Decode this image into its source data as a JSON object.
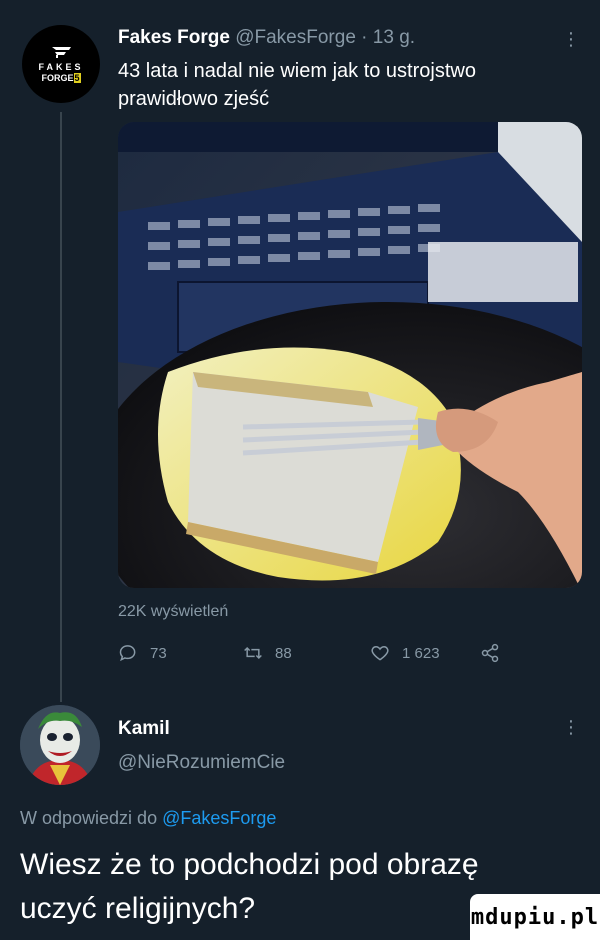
{
  "tweet": {
    "author_name": "Fakes Forge",
    "author_handle": "@FakesForge",
    "separator": "·",
    "time": "13 g.",
    "text": "43 lata i nadal nie wiem jak to ustrojstwo prawidłowo zjeść",
    "avatar": {
      "line1": "FAKES",
      "line2": "FORGE",
      "badge": "5"
    },
    "views": "22K wyświetleń",
    "stats": {
      "replies": "73",
      "retweets": "88",
      "likes": "1 623"
    },
    "icons": {
      "reply": "reply-icon",
      "retweet": "retweet-icon",
      "like": "heart-icon",
      "share": "share-icon",
      "more": "more-icon"
    }
  },
  "reply": {
    "author_name": "Kamil",
    "author_handle": "@NieRozumiemCie",
    "context_prefix": "W odpowiedzi do",
    "context_mention": "@FakesForge",
    "text": "Wiesz że to podchodzi pod obrazę uczyć religijnych?"
  },
  "watermark": "mdupiu.pl",
  "colors": {
    "background": "#15202b",
    "secondary_text": "#8899a6",
    "link": "#1d9bf0",
    "divider": "#38444d"
  }
}
